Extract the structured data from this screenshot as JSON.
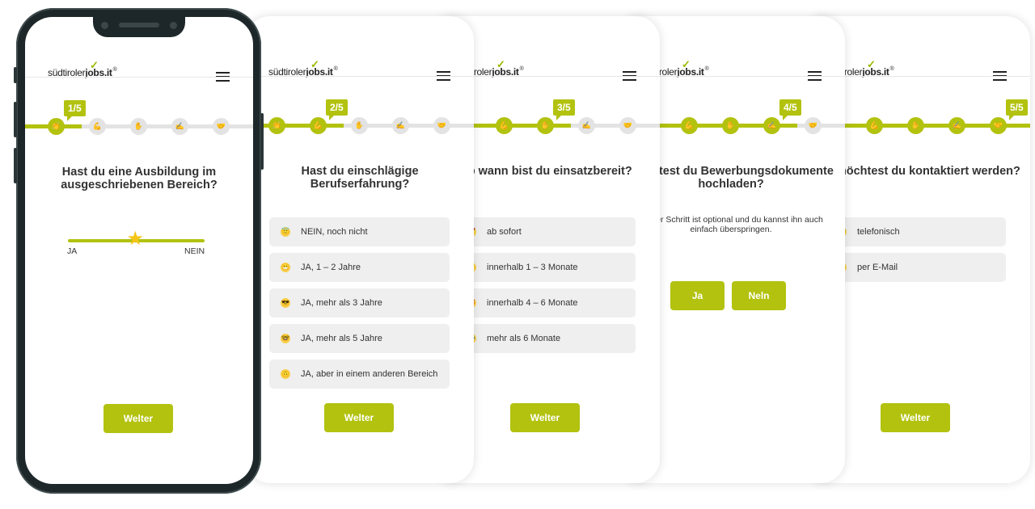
{
  "brand": {
    "logo_text_light": "südtiroler",
    "logo_text_bold": "jobs.it",
    "logo_reg": "®",
    "accent": "#b2c20f"
  },
  "progress_icons": [
    "clapping-hands-icon",
    "flexed-biceps-icon",
    "raised-hand-icon",
    "writing-hand-icon",
    "handshake-icon"
  ],
  "screens": [
    {
      "step": 1,
      "step_label": "1/5",
      "title": "Hast du eine Ausbildung im ausgeschriebenen Bereich?",
      "slider": {
        "left_label": "JA",
        "right_label": "NEIN",
        "value": 0.5
      },
      "button": "Welter"
    },
    {
      "step": 2,
      "step_label": "2/5",
      "title": "Hast du einschlägige Berufserfahrung?",
      "options": [
        {
          "icon": "halo-face-icon",
          "label": "NEIN, noch nicht"
        },
        {
          "icon": "grinning-face-icon",
          "label": "JA, 1 – 2 Jahre"
        },
        {
          "icon": "sunglasses-face-icon",
          "label": "JA, mehr als 3 Jahre"
        },
        {
          "icon": "nerd-face-icon",
          "label": "JA, mehr als 5 Jahre"
        },
        {
          "icon": "upside-down-face-icon",
          "label": "JA, aber in einem anderen Bereich"
        }
      ],
      "button": "Welter"
    },
    {
      "step": 3,
      "step_label": "3/5",
      "title": "Ab wann bist du einsatzbereit?",
      "options": [
        {
          "icon": "rocket-icon",
          "label": "ab sofort"
        },
        {
          "icon": "lightning-icon",
          "label": "innerhalb 1 – 3 Monate"
        },
        {
          "icon": "alarm-clock-icon",
          "label": "innerhalb 4 – 6 Monate"
        },
        {
          "icon": "zzz-icon",
          "label": "mehr als 6 Monate"
        }
      ],
      "button": "Welter"
    },
    {
      "step": 4,
      "step_label": "4/5",
      "title": "Möchtest du Bewerbungsdokumente hochladen?",
      "subtitle": "Dieser Schritt ist optional und du kannst ihn auch einfach überspringen.",
      "yes": "Ja",
      "no": "Neln"
    },
    {
      "step": 5,
      "step_label": "5/5",
      "title": "Wie möchtest du kontaktiert werden?",
      "options": [
        {
          "icon": "telephone-icon",
          "label": "telefonisch"
        },
        {
          "icon": "love-letter-icon",
          "label": "per E-Mail"
        }
      ],
      "button": "Welter"
    }
  ]
}
